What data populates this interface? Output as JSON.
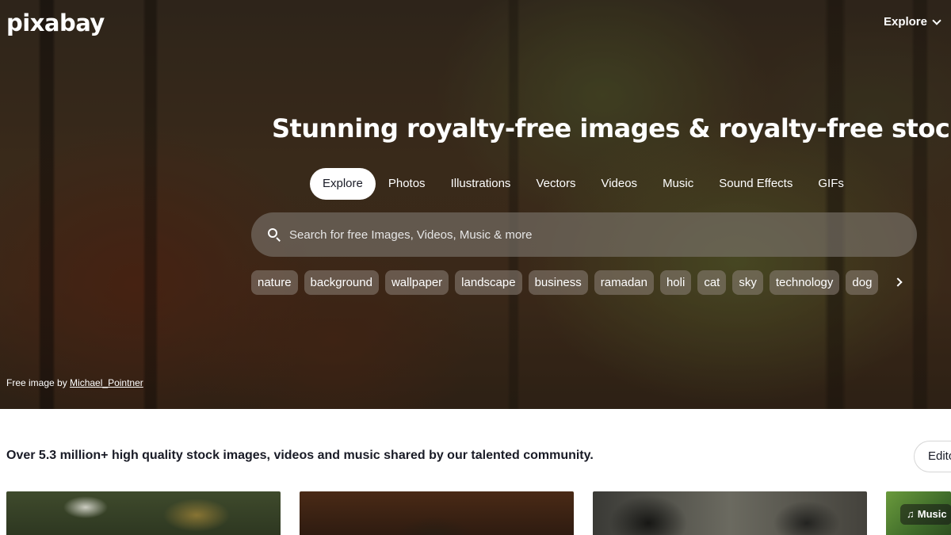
{
  "brand": {
    "logo_text": "pixabay"
  },
  "header": {
    "explore_label": "Explore"
  },
  "hero": {
    "headline": "Stunning royalty-free images & royalty-free stock",
    "tabs": [
      {
        "label": "Explore",
        "active": true
      },
      {
        "label": "Photos"
      },
      {
        "label": "Illustrations"
      },
      {
        "label": "Vectors"
      },
      {
        "label": "Videos"
      },
      {
        "label": "Music"
      },
      {
        "label": "Sound Effects"
      },
      {
        "label": "GIFs"
      }
    ],
    "search": {
      "placeholder": "Search for free Images, Videos, Music & more",
      "icon": "search-icon"
    },
    "chips": [
      "nature",
      "background",
      "wallpaper",
      "landscape",
      "business",
      "ramadan",
      "holi",
      "cat",
      "sky",
      "technology",
      "dog"
    ],
    "credit": {
      "prefix": "Free image by",
      "author": "Michael_Pointner"
    }
  },
  "main": {
    "tagline": "Over 5.3 million+ high quality stock images, videos and music shared by our talented community.",
    "editor_button": "Editor's Choice",
    "music_badge": "Music"
  }
}
